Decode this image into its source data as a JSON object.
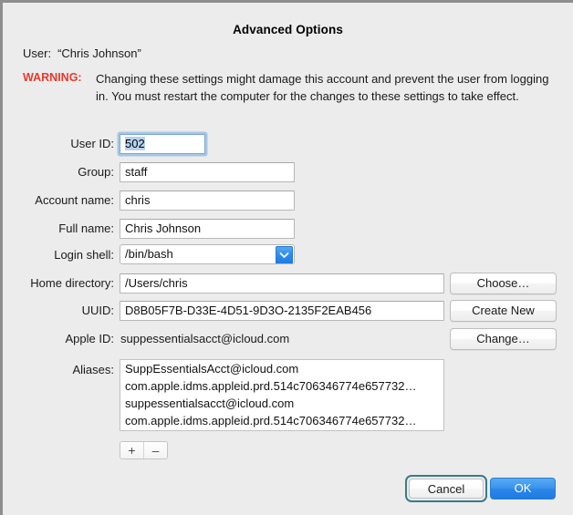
{
  "dialog": {
    "title": "Advanced Options",
    "user_label": "User:",
    "user_value": "“Chris Johnson”",
    "warning_word": "WARNING:",
    "warning_text": "Changing these settings might damage this account and prevent the user from logging in. You must restart the computer for the changes to these settings to take effect."
  },
  "fields": {
    "user_id": {
      "label": "User ID:",
      "value": "502",
      "focused": true,
      "selected": true
    },
    "group": {
      "label": "Group:",
      "value": "staff"
    },
    "account_name": {
      "label": "Account name:",
      "value": "chris"
    },
    "full_name": {
      "label": "Full name:",
      "value": "Chris Johnson"
    },
    "login_shell": {
      "label": "Login shell:",
      "value": "/bin/bash"
    },
    "home_directory": {
      "label": "Home directory:",
      "value": "/Users/chris"
    },
    "uuid": {
      "label": "UUID:",
      "value": "D8B05F7B-D33E-4D51-9D3O-2135F2EAB456"
    },
    "apple_id": {
      "label": "Apple ID:",
      "value": "suppessentialsacct@icloud.com"
    },
    "aliases": {
      "label": "Aliases:"
    }
  },
  "aliases": [
    "SuppEssentialsAcct@icloud.com",
    "com.apple.idms.appleid.prd.514c706346774e657732…",
    "suppessentialsacct@icloud.com",
    "com.apple.idms.appleid.prd.514c706346774e657732…"
  ],
  "buttons": {
    "choose": "Choose…",
    "create_new": "Create New",
    "change": "Change…",
    "add": "+",
    "remove": "–",
    "cancel": "Cancel",
    "ok": "OK"
  },
  "icons": {
    "popup_chevron": "chevron-down-icon"
  },
  "colors": {
    "warning": "#e8392e",
    "accent": "#2b87e8",
    "focus_ring": "#7daFe2",
    "default_focus_ring": "#3a7a8c",
    "selection": "#b6d3f0",
    "window_bg": "#ececec"
  }
}
